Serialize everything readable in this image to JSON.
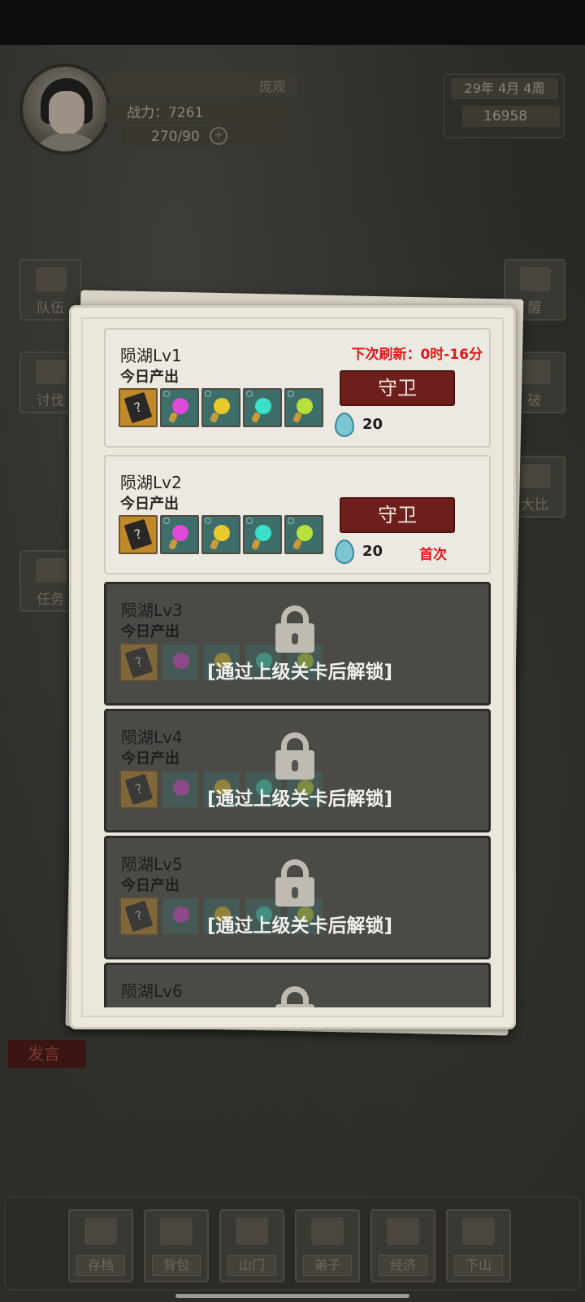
{
  "header": {
    "player_name": "庞观",
    "power": "战力：7261",
    "energy": "270/90",
    "plus": "+",
    "date": "29年  4月  4周",
    "stones": "16958"
  },
  "side_buttons": {
    "left": [
      "队伍",
      "讨伐",
      "任务"
    ],
    "right": [
      "醒",
      "破",
      "大比"
    ]
  },
  "speak_label": "发言",
  "modal": {
    "stages": [
      {
        "title": "陨湖Lv1",
        "subtitle": "今日产出",
        "refresh": "下次刷新：0时-16分",
        "button": "守卫",
        "cost": "20",
        "badge": ""
      },
      {
        "title": "陨湖Lv2",
        "subtitle": "今日产出",
        "refresh": "",
        "button": "守卫",
        "cost": "20",
        "badge": "首次"
      },
      {
        "title": "陨湖Lv3",
        "subtitle": "今日产出",
        "lock_text": "[通过上级关卡后解锁]"
      },
      {
        "title": "陨湖Lv4",
        "subtitle": "今日产出",
        "lock_text": "[通过上级关卡后解锁]"
      },
      {
        "title": "陨湖Lv5",
        "subtitle": "今日产出",
        "lock_text": "[通过上级关卡后解锁]"
      },
      {
        "title": "陨湖Lv6",
        "subtitle": "",
        "lock_text": ""
      }
    ],
    "item_icons": [
      "mystery-book-icon",
      "pink-gem-icon",
      "yellow-gem-icon",
      "cyan-gem-icon",
      "lime-gem-icon"
    ],
    "gem_colors": [
      "#e04ad8",
      "#e8c82a",
      "#3ae0c8",
      "#b8e03a"
    ],
    "book_glyph": "?"
  },
  "bottom_nav": [
    "存档",
    "背包",
    "山门",
    "弟子",
    "经济",
    "下山"
  ]
}
